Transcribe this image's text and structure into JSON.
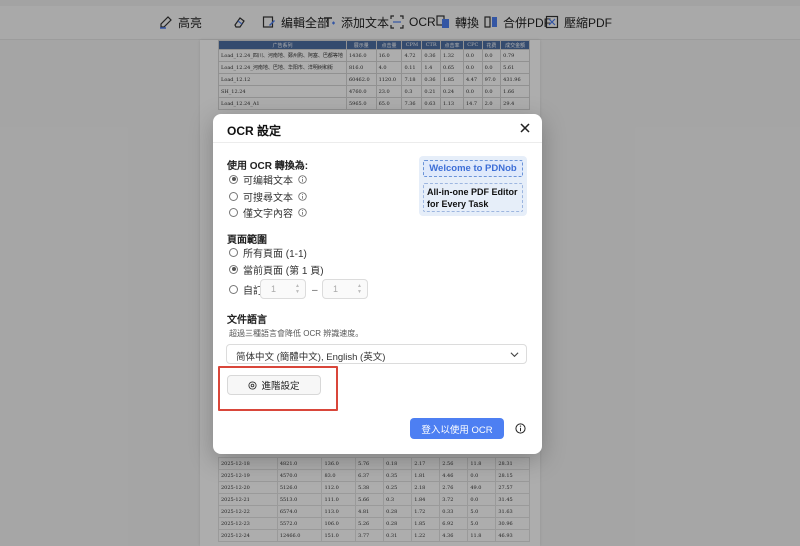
{
  "toolbar": {
    "items": [
      {
        "label": "高亮"
      },
      {
        "label": ""
      },
      {
        "label": "编輯全部"
      },
      {
        "label": "添加文本"
      },
      {
        "label": "OCR"
      },
      {
        "label": "轉換"
      },
      {
        "label": "合併PDF"
      },
      {
        "label": "壓縮PDF"
      }
    ]
  },
  "document": {
    "header_row": [
      "广告系列",
      "展示量",
      "点击量",
      "CPM",
      "CTR",
      "点击率",
      "CPC",
      "花费",
      "成交金额",
      "总成交"
    ],
    "rows": [
      [
        "Load_12.24_四川、河南地、鄭州购、阿塞、巴都等地",
        "1436.0",
        "16.0",
        "4.72",
        "0.36",
        "1.32",
        "0.0",
        "0.0",
        "0.79"
      ],
      [
        "Load_12.24_河南地、巴地、华阳市、洋明树和街",
        "816.0",
        "4.0",
        "0.11",
        "1.4",
        "0.65",
        "0.0",
        "0.0",
        "5.61"
      ],
      [
        "Load_12.12",
        "60462.0",
        "1120.0",
        "7.18",
        "0.36",
        "1.85",
        "4.47",
        "97.0",
        "431.96"
      ],
      [
        "SH_12.24",
        "4760.0",
        "23.0",
        "0.3",
        "0.21",
        "0.24",
        "0.0",
        "0.0",
        "1.66"
      ],
      [
        "Load_12.24_A1",
        "5965.0",
        "65.0",
        "7.36",
        "0.63",
        "1.13",
        "14.7",
        "2.0",
        "29.4"
      ]
    ],
    "lower_rows": [
      [
        "2025-12-18",
        "4821.0",
        "136.0",
        "5.76",
        "0.18",
        "2.17",
        "2.56",
        "11.8",
        "28.31"
      ],
      [
        "2025-12-19",
        "4570.0",
        "83.0",
        "6.37",
        "0.35",
        "1.81",
        "4.46",
        "0.0",
        "28.15"
      ],
      [
        "2025-12-20",
        "5126.0",
        "112.0",
        "5.38",
        "0.25",
        "2.18",
        "2.76",
        "49.0",
        "27.57"
      ],
      [
        "2025-12-21",
        "5513.0",
        "111.0",
        "5.66",
        "0.3",
        "1.84",
        "3.72",
        "0.0",
        "31.45"
      ],
      [
        "2025-12-22",
        "6574.0",
        "113.0",
        "4.81",
        "0.28",
        "1.72",
        "0.33",
        "5.0",
        "31.63"
      ],
      [
        "2025-12-23",
        "5572.0",
        "106.0",
        "5.26",
        "0.28",
        "1.85",
        "6.92",
        "5.0",
        "30.96"
      ],
      [
        "2025-12-24",
        "12466.0",
        "151.0",
        "3.77",
        "0.31",
        "1.22",
        "4.36",
        "11.8",
        "46.93"
      ]
    ]
  },
  "dialog": {
    "title": "OCR 設定",
    "convert_section": {
      "title": "使用 OCR 轉換為:",
      "options": [
        {
          "label": "可编輯文本",
          "checked": true
        },
        {
          "label": "可搜尋文本",
          "checked": false
        },
        {
          "label": "僅文字內容",
          "checked": false
        }
      ]
    },
    "banner": {
      "top": "Welcome to PDNob",
      "line1": "All-in-one PDF Editor",
      "line2": "for Every Task"
    },
    "page_range": {
      "title": "頁面範圍",
      "options": [
        {
          "label": "所有頁面 (1-1)",
          "checked": false
        },
        {
          "label": "當前頁面 (第 1 頁)",
          "checked": true
        },
        {
          "label": "自訂",
          "checked": false
        }
      ],
      "from_value": "1",
      "dash": "–",
      "to_value": "1"
    },
    "language": {
      "title": "文件語言",
      "hint": "超過三種語言會降低 OCR 辨識速度。",
      "selected": "简体中文 (簡體中文), English (英文)"
    },
    "advanced_button": "進階設定",
    "primary_button": "登入以使用 OCR"
  }
}
